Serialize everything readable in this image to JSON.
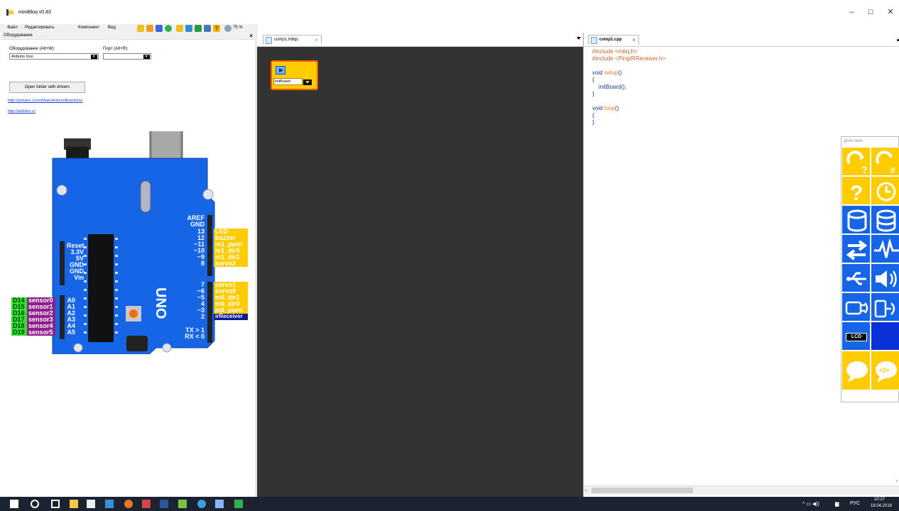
{
  "window": {
    "title": "miniBloq v0.83",
    "minimize": "–",
    "maximize": "☐",
    "close": "✕"
  },
  "menu": [
    "Файл",
    "Редактировать",
    "Компонент",
    "Вид"
  ],
  "toolbar": {
    "zoom": "75 %"
  },
  "hardware": {
    "panel_title": "Оборудование",
    "board_label": "Оборудование (Alt+W):",
    "board_value": "Arduino Uno",
    "port_label": "Порт (Alt+R):",
    "port_value": "",
    "open_folder_button": "Open folder with drivers",
    "links": [
      "http://arduino.cc/en/Main/ArduinoBoardUno",
      "http://arduino.cc"
    ],
    "board_name": "UNO",
    "left_header_pins": [
      "Reset",
      "3.3V",
      "5V",
      "GND",
      "GND",
      "Vin"
    ],
    "analog_pins": [
      "A0",
      "A1",
      "A2",
      "A3",
      "A4",
      "A5"
    ],
    "analog_digital": [
      "D14",
      "D15",
      "D16",
      "D17",
      "D18",
      "D19"
    ],
    "analog_sensors": [
      "sensor0",
      "sensor1",
      "sensor2",
      "sensor3",
      "sensor4",
      "sensor5"
    ],
    "top_pins": [
      "AREF",
      "GND",
      "13",
      "12",
      "~11",
      "~10",
      "~9",
      "8"
    ],
    "top_labels": [
      "",
      "",
      "LED",
      "buzzer",
      "m1_pwm",
      "m1_dir0",
      "m1_dir1",
      "servo2"
    ],
    "bottom_pins": [
      "7",
      "~6",
      "~5",
      "4",
      "~3",
      "2",
      "TX > 1",
      "RX < 0"
    ],
    "bottom_labels": [
      "servo1",
      "servo0",
      "m0_dir1",
      "m0_dir0",
      "m0_pwm",
      "irReceiver",
      "",
      ""
    ]
  },
  "program": {
    "tab_label": "comp1.mbqc",
    "block_label": "initBoard"
  },
  "code": {
    "tab_label": "comp1.cpp",
    "lines": [
      {
        "text": "#include <mbq.h>",
        "cls": "inc"
      },
      {
        "text": "#include <PingIRReceiver.h>",
        "cls": "inc"
      },
      {
        "text": "",
        "cls": ""
      },
      {
        "text": "void ",
        "cls": "kw",
        "fn": "setup",
        "tail": "()"
      },
      {
        "text": "{",
        "cls": "kw"
      },
      {
        "text": "    initBoard();",
        "cls": "kw"
      },
      {
        "text": "}",
        "cls": "kw"
      },
      {
        "text": "",
        "cls": ""
      },
      {
        "text": "void ",
        "cls": "kw",
        "fn": "loop",
        "tail": "()"
      },
      {
        "text": "{",
        "cls": "kw"
      },
      {
        "text": "}",
        "cls": "kw"
      }
    ]
  },
  "actions": {
    "title": "Действия",
    "lcd_label": "LCD"
  },
  "taskbar": {
    "lang": "РУС",
    "time": "10:27",
    "date": "18.04.2016"
  },
  "colors": {
    "accent_yellow": "#ffcc00",
    "board_blue": "#1565e6",
    "canvas": "#333333"
  }
}
